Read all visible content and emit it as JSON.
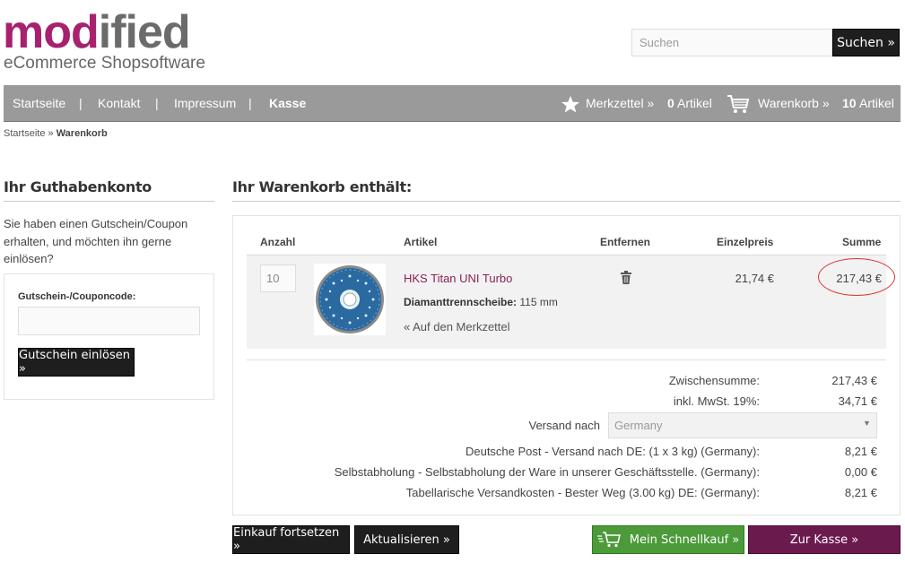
{
  "logo": {
    "part1": "mod",
    "part2": "ified",
    "tagline": "eCommerce Shopsoftware"
  },
  "search": {
    "placeholder": "Suchen",
    "button_label": "Suchen »"
  },
  "nav": {
    "items": [
      "Startseite",
      "Kontakt",
      "Impressum",
      "Kasse"
    ],
    "separator": "|",
    "wishlist_label": "Merkzettel »",
    "wishlist_count": "0",
    "wishlist_unit": "Artikel",
    "cart_label": "Warenkorb »",
    "cart_count": "10",
    "cart_unit": "Artikel"
  },
  "breadcrumb": {
    "home": "Startseite",
    "sep": " » ",
    "current": "Warenkorb"
  },
  "coupon": {
    "title": "Ihr Guthabenkonto",
    "text": "Sie haben einen Gutschein/Coupon erhalten, und möchten ihn gerne einlösen?",
    "field_label": "Gutschein-/Couponcode:",
    "button_label": "Gutschein einlösen »"
  },
  "cart": {
    "title": "Ihr Warenkorb enthält:",
    "headers": {
      "qty": "Anzahl",
      "article": "Artikel",
      "remove": "Entfernen",
      "unit_price": "Einzelpreis",
      "sum": "Summe"
    },
    "item": {
      "qty": "10",
      "name": "HKS Titan UNI Turbo",
      "attr_label": "Diamanttrennscheibe:",
      "attr_value": " 115 mm",
      "wishlist_link": "« Auf den Merkzettel",
      "unit_price": "21,74 €",
      "sum": "217,43 €"
    },
    "totals": {
      "subtotal_label": "Zwischensumme:",
      "subtotal_value": "217,43 €",
      "vat_label": "inkl. MwSt. 19%:",
      "vat_value": "34,71 €",
      "shipping_to_label": "Versand nach",
      "shipping_country": "Germany",
      "shipping_options": [
        {
          "label": "Deutsche Post - Versand nach DE: (1 x 3 kg) (Germany):",
          "value": "8,21 €"
        },
        {
          "label": "Selbstabholung - Selbstabholung der Ware in unserer Geschäftsstelle. (Germany):",
          "value": "0,00 €"
        },
        {
          "label": "Tabellarische Versandkosten - Bester Weg (3.00 kg) DE: (Germany):",
          "value": "8,21 €"
        }
      ]
    },
    "buttons": {
      "continue": "Einkauf fortsetzen »",
      "update": "Aktualisieren »",
      "express": "Mein Schnellkauf »",
      "checkout": "Zur Kasse »"
    }
  },
  "colors": {
    "brand_pink": "#a8216f",
    "nav_bg": "#9a9a9a",
    "express_green": "#4c9a3a",
    "checkout_purple": "#6b1a4e"
  }
}
